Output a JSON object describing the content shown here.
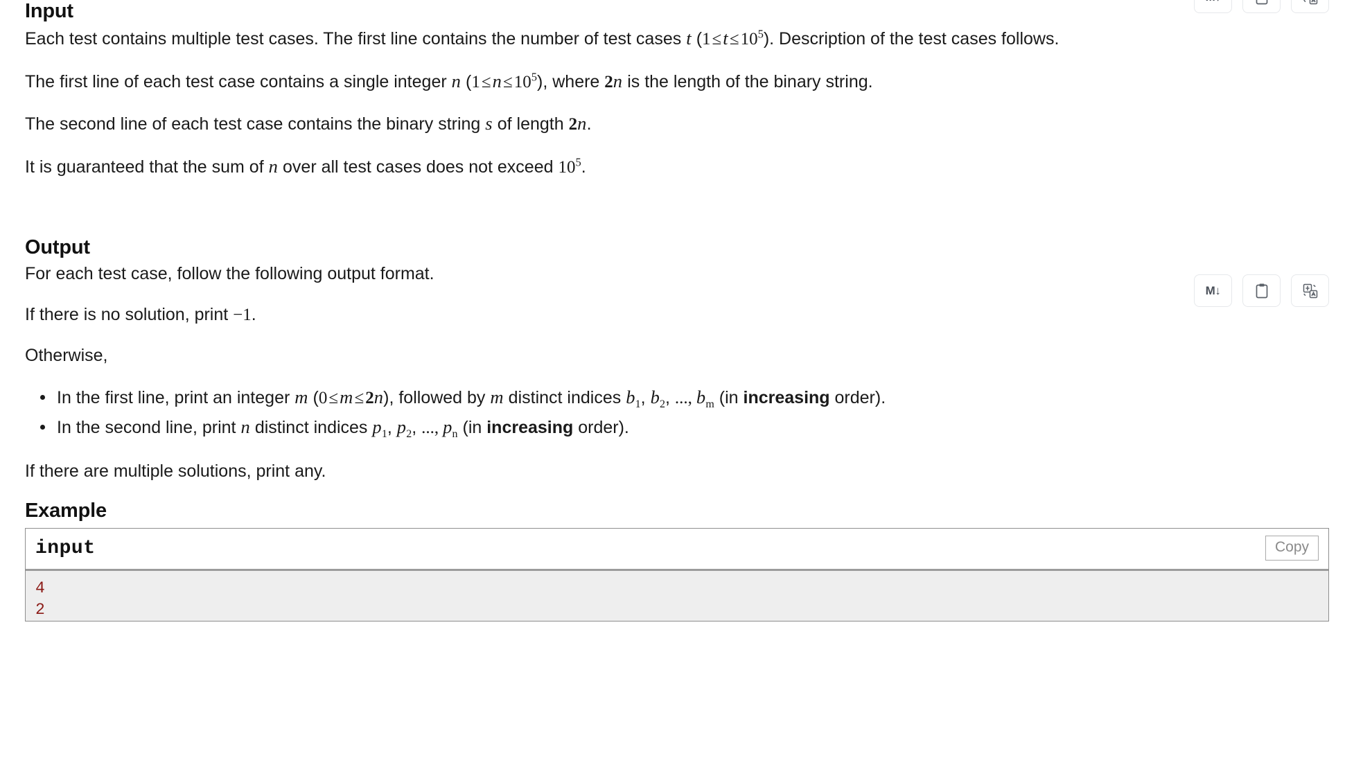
{
  "input_section": {
    "heading": "Input",
    "p1_a": "Each test contains multiple test cases. The first line contains the number of test cases ",
    "p1_t": "t",
    "p1_b": " (",
    "p1_one": "1",
    "p1_le1": "≤",
    "p1_t2": "t",
    "p1_le2": "≤",
    "p1_ten": "10",
    "p1_exp": "5",
    "p1_c": "). Description of the test cases follows.",
    "p2_a": "The first line of each test case contains a single integer ",
    "p2_n": "n",
    "p2_b": " (",
    "p2_one": "1",
    "p2_le1": "≤",
    "p2_n2": "n",
    "p2_le2": "≤",
    "p2_ten": "10",
    "p2_exp": "5",
    "p2_c": "), where ",
    "p2_2n_num": "2",
    "p2_2n_var": "n",
    "p2_d": " is the length of the binary string.",
    "p3_a": "The second line of each test case contains the binary string ",
    "p3_s": "s",
    "p3_b": " of length ",
    "p3_2n_num": "2",
    "p3_2n_var": "n",
    "p3_c": ".",
    "p4_a": "It is guaranteed that the sum of ",
    "p4_n": "n",
    "p4_b": " over all test cases does not exceed ",
    "p4_ten": "10",
    "p4_exp": "5",
    "p4_c": "."
  },
  "output_section": {
    "heading": "Output",
    "p1": "For each test case, follow the following output format.",
    "p2_a": "If there is no solution, print ",
    "p2_minus": "−1",
    "p2_b": ".",
    "p3": "Otherwise,",
    "bullet1": {
      "a": "In the first line, print an integer ",
      "m": "m",
      "b": " (",
      "zero": "0",
      "le1": "≤",
      "m2": "m",
      "le2": "≤",
      "two": "2",
      "n": "n",
      "c": "), followed by ",
      "m3": "m",
      "d": " distinct indices ",
      "b1_var": "b",
      "b1_sub": "1",
      "comma1": ", ",
      "b2_var": "b",
      "b2_sub": "2",
      "comma2": ", ",
      "ellipsis": "...,",
      "bm_var": "b",
      "bm_sub": "m",
      "e": " (in ",
      "increasing": "increasing",
      "f": " order)."
    },
    "bullet2": {
      "a": "In the second line, print ",
      "n": "n",
      "b": " distinct indices ",
      "p1_var": "p",
      "p1_sub": "1",
      "comma1": ", ",
      "p2_var": "p",
      "p2_sub": "2",
      "comma2": ", ",
      "ellipsis": "...,",
      "pn_var": "p",
      "pn_sub": "n",
      "c": " (in ",
      "increasing": "increasing",
      "d": " order)."
    },
    "p4": "If there are multiple solutions, print any."
  },
  "example_section": {
    "heading": "Example",
    "block_title": "input",
    "copy_label": "Copy",
    "lines": [
      "4",
      "2"
    ]
  },
  "toolbar": {
    "markdown_label": "M",
    "markdown_arrow": "↓",
    "icons": [
      "markdown-download-icon",
      "clipboard-icon",
      "translate-icon"
    ]
  },
  "colors": {
    "code_text": "#8b1a16",
    "code_bg": "#eeeeee",
    "border": "#8e8e8e",
    "icon": "#5b6169"
  }
}
